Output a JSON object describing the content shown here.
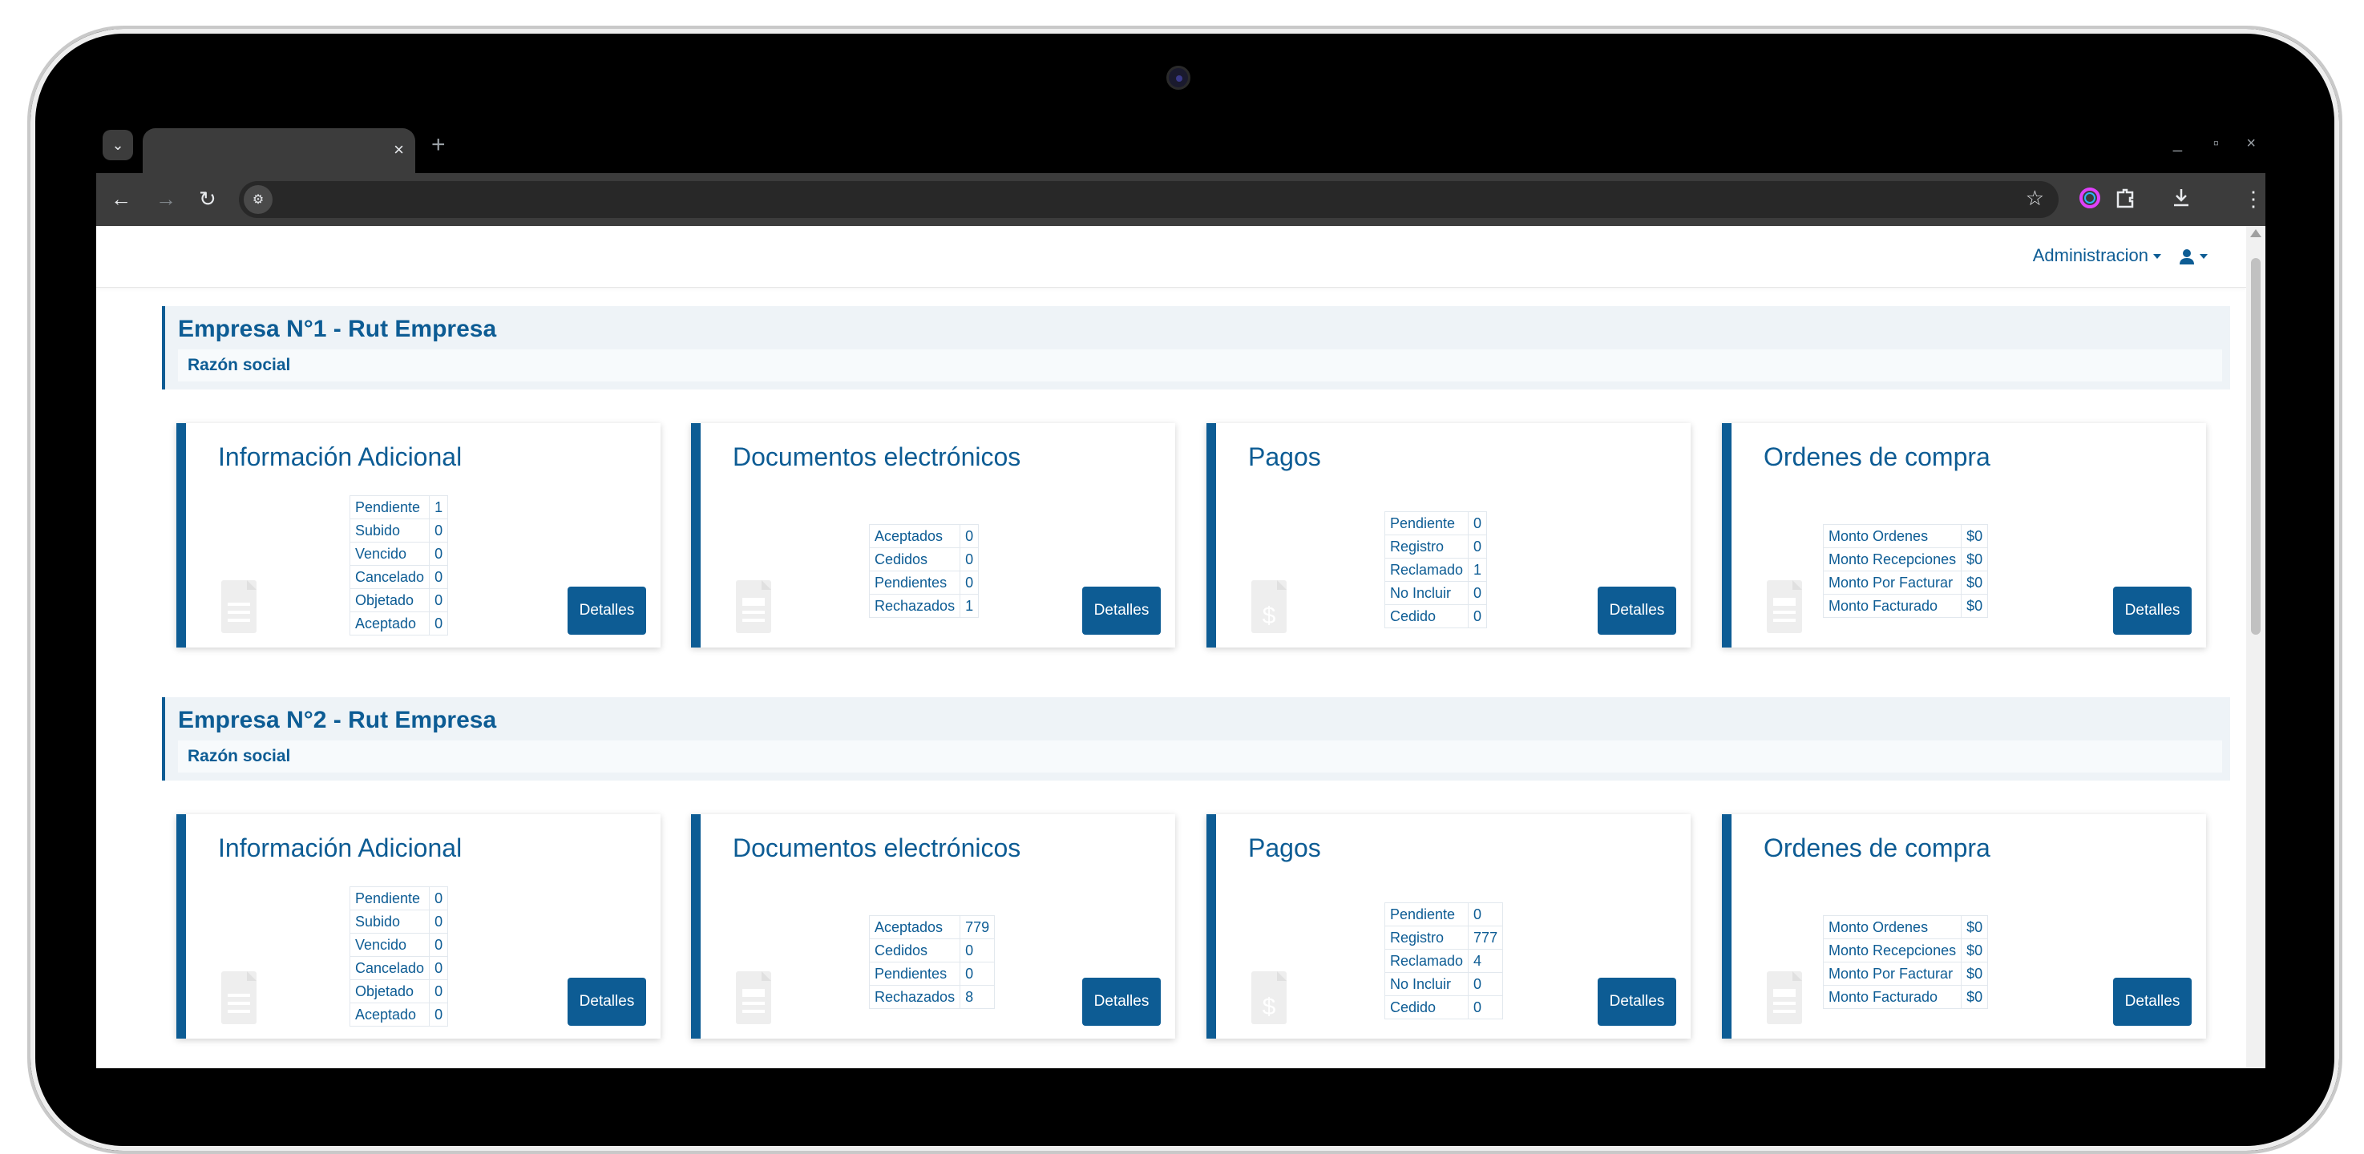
{
  "browser": {
    "tab_close": "×",
    "new_tab": "+",
    "window_controls": [
      "_",
      "▫",
      "×"
    ]
  },
  "navbar": {
    "admin_label": "Administracion"
  },
  "companies": [
    {
      "title": "Empresa N°1 - Rut Empresa",
      "subtitle": "Razón social",
      "cards": [
        {
          "title": "Información Adicional",
          "button": "Detalles",
          "icon": "document-icon",
          "rows": [
            [
              "Pendiente",
              "1"
            ],
            [
              "Subido",
              "0"
            ],
            [
              "Vencido",
              "0"
            ],
            [
              "Cancelado",
              "0"
            ],
            [
              "Objetado",
              "0"
            ],
            [
              "Aceptado",
              "0"
            ]
          ]
        },
        {
          "title": "Documentos electrónicos",
          "button": "Detalles",
          "icon": "invoice-icon",
          "rows": [
            [
              "Aceptados",
              "0"
            ],
            [
              "Cedidos",
              "0"
            ],
            [
              "Pendientes",
              "0"
            ],
            [
              "Rechazados",
              "1"
            ]
          ]
        },
        {
          "title": "Pagos",
          "button": "Detalles",
          "icon": "payment-document-icon",
          "rows": [
            [
              "Pendiente",
              "0"
            ],
            [
              "Registro",
              "0"
            ],
            [
              "Reclamado",
              "1"
            ],
            [
              "No Incluir",
              "0"
            ],
            [
              "Cedido",
              "0"
            ]
          ]
        },
        {
          "title": "Ordenes de compra",
          "button": "Detalles",
          "icon": "invoice-icon",
          "rows": [
            [
              "Monto Ordenes",
              "$0"
            ],
            [
              "Monto Recepciones",
              "$0"
            ],
            [
              "Monto Por Facturar",
              "$0"
            ],
            [
              "Monto Facturado",
              "$0"
            ]
          ]
        }
      ]
    },
    {
      "title": "Empresa N°2 - Rut Empresa",
      "subtitle": "Razón social",
      "cards": [
        {
          "title": "Información Adicional",
          "button": "Detalles",
          "icon": "document-icon",
          "rows": [
            [
              "Pendiente",
              "0"
            ],
            [
              "Subido",
              "0"
            ],
            [
              "Vencido",
              "0"
            ],
            [
              "Cancelado",
              "0"
            ],
            [
              "Objetado",
              "0"
            ],
            [
              "Aceptado",
              "0"
            ]
          ]
        },
        {
          "title": "Documentos electrónicos",
          "button": "Detalles",
          "icon": "invoice-icon",
          "rows": [
            [
              "Aceptados",
              "779"
            ],
            [
              "Cedidos",
              "0"
            ],
            [
              "Pendientes",
              "0"
            ],
            [
              "Rechazados",
              "8"
            ]
          ]
        },
        {
          "title": "Pagos",
          "button": "Detalles",
          "icon": "payment-document-icon",
          "rows": [
            [
              "Pendiente",
              "0"
            ],
            [
              "Registro",
              "777"
            ],
            [
              "Reclamado",
              "4"
            ],
            [
              "No Incluir",
              "0"
            ],
            [
              "Cedido",
              "0"
            ]
          ]
        },
        {
          "title": "Ordenes de compra",
          "button": "Detalles",
          "icon": "invoice-icon",
          "rows": [
            [
              "Monto Ordenes",
              "$0"
            ],
            [
              "Monto Recepciones",
              "$0"
            ],
            [
              "Monto Por Facturar",
              "$0"
            ],
            [
              "Monto Facturado",
              "$0"
            ]
          ]
        }
      ]
    }
  ],
  "colors": {
    "primary": "#0d5c94",
    "header_bg": "#eef3f7"
  }
}
